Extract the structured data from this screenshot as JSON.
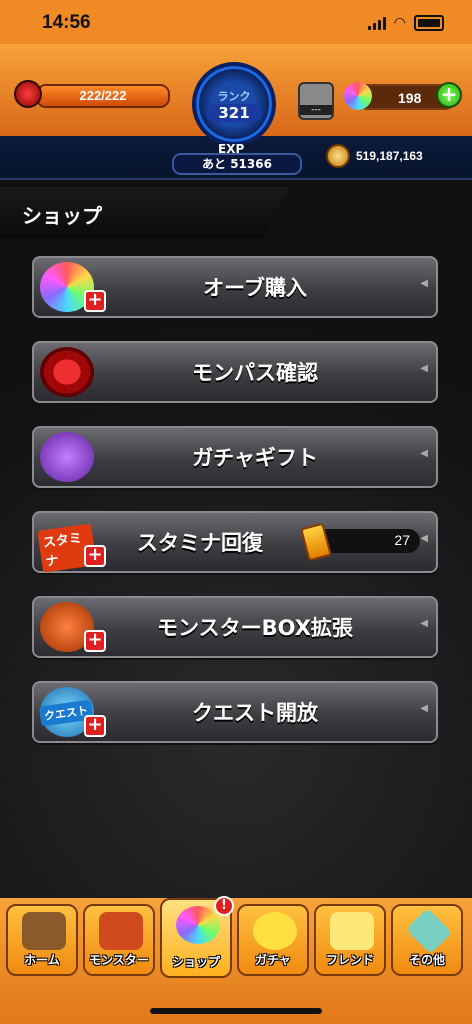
{
  "status_bar": {
    "time": "14:56"
  },
  "header": {
    "stamina": {
      "value": "222/222",
      "fill_fraction": 1.0
    },
    "rank": {
      "label": "ランク",
      "value": "321"
    },
    "exp": {
      "label": "EXP",
      "remaining": "あと 51366"
    },
    "sp_slot": {
      "text": "---"
    },
    "orbs": {
      "count": "198"
    },
    "coins": {
      "value": "519,187,163"
    }
  },
  "page": {
    "title": "ショップ"
  },
  "menu": [
    {
      "label": "オーブ購入",
      "icon": "rainbow-orb-icon"
    },
    {
      "label": "モンパス確認",
      "icon": "monpass-icon"
    },
    {
      "label": "ガチャギフト",
      "icon": "gift-orb-icon"
    },
    {
      "label": "スタミナ回復",
      "icon": "stamina-icon",
      "tag": "スタミナ",
      "item_count": "27"
    },
    {
      "label": "モンスターBOX拡張",
      "icon": "monster-box-icon"
    },
    {
      "label": "クエスト開放",
      "icon": "quest-icon",
      "tag": "クエスト"
    }
  ],
  "nav": [
    {
      "label": "ホーム",
      "icon": "home-icon"
    },
    {
      "label": "モンスター",
      "icon": "monster-icon"
    },
    {
      "label": "ショップ",
      "icon": "shop-icon",
      "alert": "!"
    },
    {
      "label": "ガチャ",
      "icon": "gacha-icon"
    },
    {
      "label": "フレンド",
      "icon": "friend-icon"
    },
    {
      "label": "その他",
      "icon": "other-icon"
    }
  ],
  "colors": {
    "accent": "#f08a24",
    "plus_red": "#e02020",
    "rank_blue": "#1a4aa8"
  }
}
